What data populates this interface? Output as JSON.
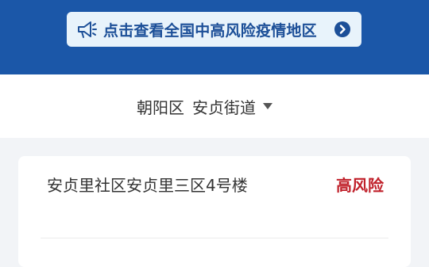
{
  "banner": {
    "text": "点击查看全国中高风险疫情地区",
    "icon_left": "megaphone-icon",
    "icon_right": "chevron-right-circle-icon"
  },
  "location": {
    "district": "朝阳区",
    "street": "安贞街道",
    "icon": "caret-down-icon"
  },
  "areas": [
    {
      "address": "安贞里社区安贞里三区4号楼",
      "risk": "高风险"
    }
  ],
  "colors": {
    "header": "#1b57a8",
    "banner_bg": "#e8f3fb",
    "banner_text": "#1c4f98",
    "risk_high": "#c0202a",
    "page_bg": "#f2f4f7"
  }
}
